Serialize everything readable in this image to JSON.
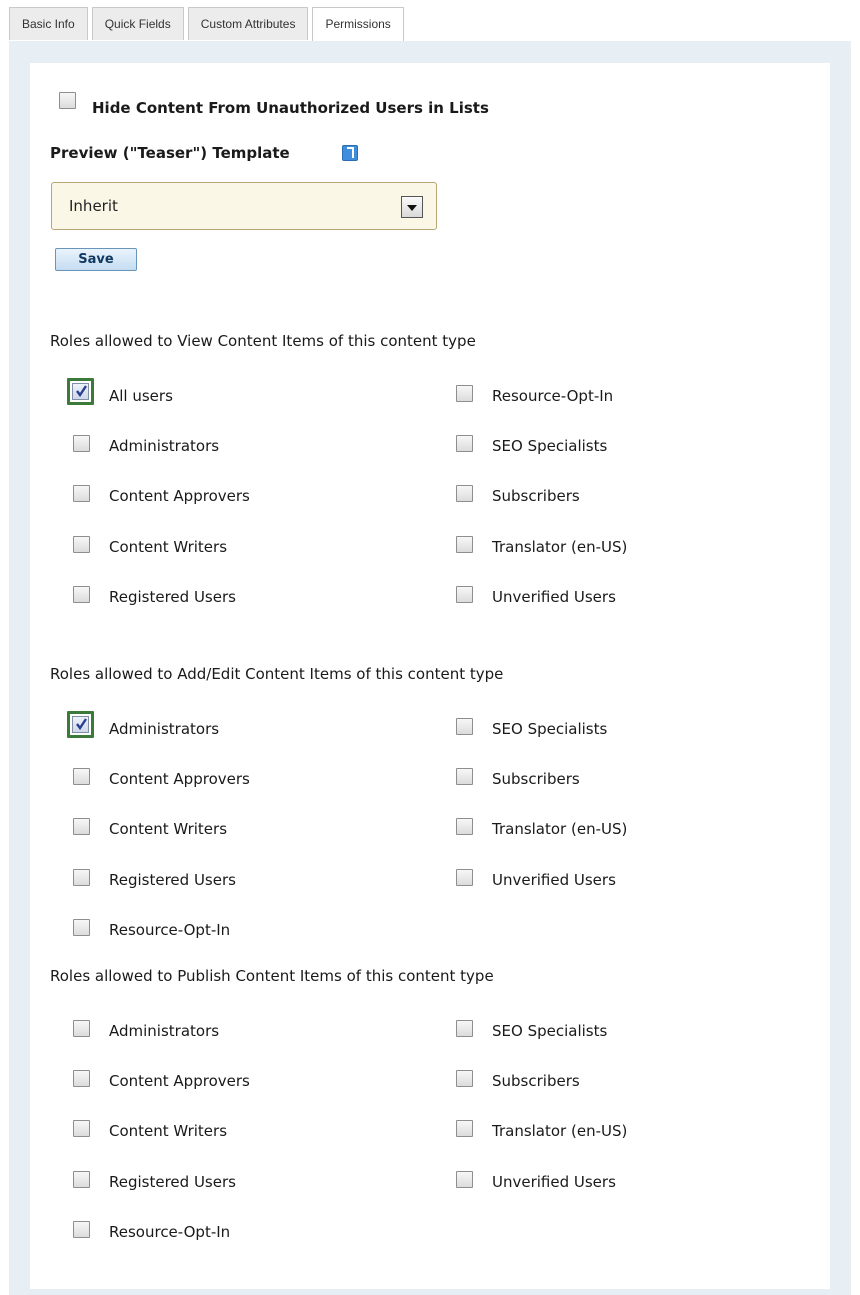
{
  "tabs": [
    "Basic Info",
    "Quick Fields",
    "Custom Attributes",
    "Permissions"
  ],
  "active_tab": "Permissions",
  "hide_content": {
    "label": "Hide Content From Unauthorized Users in Lists",
    "checked": false
  },
  "teaser": {
    "label": "Preview (\"Teaser\") Template",
    "help_icon": "help-icon",
    "selected": "Inherit"
  },
  "save_label": "Save",
  "view_section": {
    "heading": "Roles allowed to View Content Items of this content type",
    "left": [
      {
        "label": "All users",
        "checked": true
      },
      {
        "label": "Administrators",
        "checked": false
      },
      {
        "label": "Content Approvers",
        "checked": false
      },
      {
        "label": "Content Writers",
        "checked": false
      },
      {
        "label": "Registered Users",
        "checked": false
      }
    ],
    "right": [
      {
        "label": "Resource-Opt-In",
        "checked": false
      },
      {
        "label": "SEO Specialists",
        "checked": false
      },
      {
        "label": "Subscribers",
        "checked": false
      },
      {
        "label": "Translator (en-US)",
        "checked": false
      },
      {
        "label": "Unverified Users",
        "checked": false
      }
    ]
  },
  "edit_section": {
    "heading": "Roles allowed to Add/Edit Content Items of this content type",
    "left": [
      {
        "label": "Administrators",
        "checked": true
      },
      {
        "label": "Content Approvers",
        "checked": false
      },
      {
        "label": "Content Writers",
        "checked": false
      },
      {
        "label": "Registered Users",
        "checked": false
      },
      {
        "label": "Resource-Opt-In",
        "checked": false
      }
    ],
    "right": [
      {
        "label": "SEO Specialists",
        "checked": false
      },
      {
        "label": "Subscribers",
        "checked": false
      },
      {
        "label": "Translator (en-US)",
        "checked": false
      },
      {
        "label": "Unverified Users",
        "checked": false
      }
    ]
  },
  "publish_section": {
    "heading": "Roles allowed to Publish Content Items of this content type",
    "left": [
      {
        "label": "Administrators",
        "checked": false
      },
      {
        "label": "Content Approvers",
        "checked": false
      },
      {
        "label": "Content Writers",
        "checked": false
      },
      {
        "label": "Registered Users",
        "checked": false
      },
      {
        "label": "Resource-Opt-In",
        "checked": false
      }
    ],
    "right": [
      {
        "label": "SEO Specialists",
        "checked": false
      },
      {
        "label": "Subscribers",
        "checked": false
      },
      {
        "label": "Translator (en-US)",
        "checked": false
      },
      {
        "label": "Unverified Users",
        "checked": false
      }
    ]
  }
}
